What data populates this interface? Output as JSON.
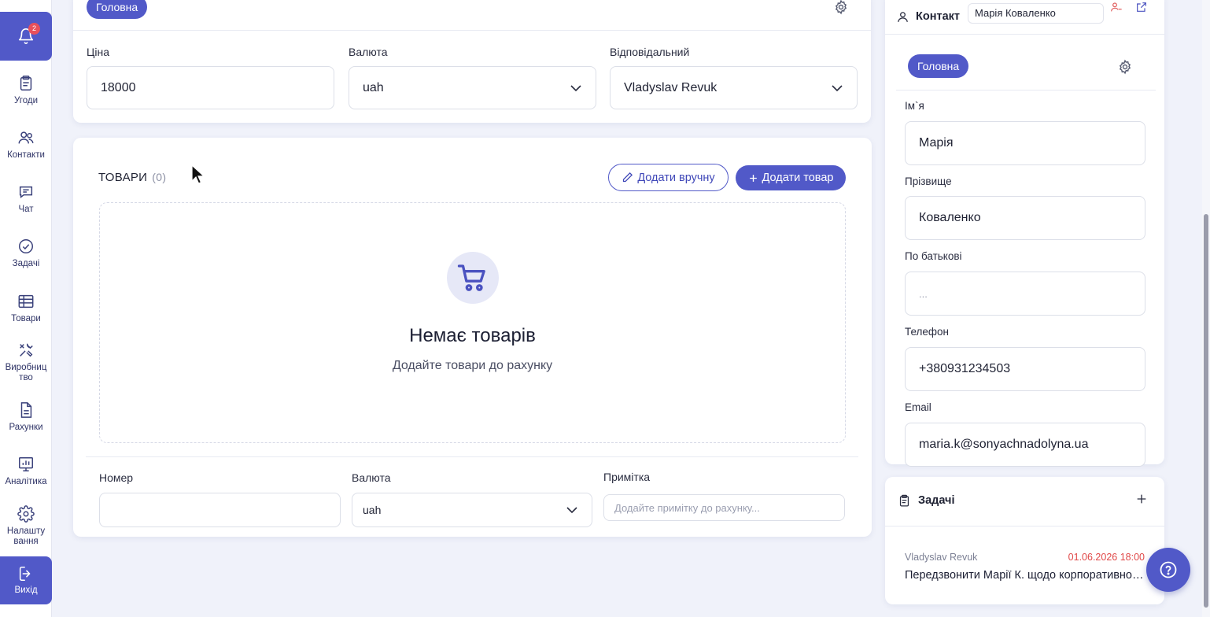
{
  "sidebar": {
    "notification_count": "2",
    "items": [
      {
        "label": "Угоди",
        "icon": "deals-icon"
      },
      {
        "label": "Контакти",
        "icon": "contacts-icon"
      },
      {
        "label": "Чат",
        "icon": "chat-icon"
      },
      {
        "label": "Задачі",
        "icon": "tasks-icon"
      },
      {
        "label": "Товари",
        "icon": "products-icon"
      },
      {
        "label": "Виробниц тво",
        "icon": "production-icon"
      },
      {
        "label": "Рахунки",
        "icon": "invoices-icon"
      },
      {
        "label": "Аналітика",
        "icon": "analytics-icon"
      },
      {
        "label": "Налашту вання",
        "icon": "settings-icon"
      }
    ],
    "logout_label": "Вихід"
  },
  "deal": {
    "tab_label": "Головна",
    "price_label": "Ціна",
    "price_value": "18000",
    "currency_label": "Валюта",
    "currency_value": "uah",
    "responsible_label": "Відповідальний",
    "responsible_value": "Vladyslav Revuk"
  },
  "goods": {
    "title": "ТОВАРИ",
    "count": "(0)",
    "add_manual_label": "Додати вручну",
    "add_product_label": "Додати товар",
    "empty_title": "Немає товарів",
    "empty_subtitle": "Додайте товари до рахунку",
    "number_label": "Номер",
    "number_value": "",
    "currency_label": "Валюта",
    "currency_value": "uah",
    "note_label": "Примітка",
    "note_placeholder": "Додайте примітку до рахунку..."
  },
  "contact": {
    "header_label": "Контакт",
    "header_value": "Марія Коваленко",
    "tab_label": "Головна",
    "first_name_label": "Ім`я",
    "first_name_value": "Марія",
    "last_name_label": "Прізвище",
    "last_name_value": "Коваленко",
    "patronymic_label": "По батькові",
    "patronymic_placeholder": "...",
    "phone_label": "Телефон",
    "phone_value": "+380931234503",
    "email_label": "Email",
    "email_value": "maria.k@sonyachnadolyna.ua"
  },
  "tasks": {
    "title": "Задачі",
    "items": [
      {
        "author": "Vladyslav Revuk",
        "due": "01.06.2026 18:00",
        "text": "Передзвонити Марії К. щодо корпоративного замовлення"
      }
    ]
  },
  "colors": {
    "accent": "#5159c8",
    "overdue": "#e04848",
    "background": "#f0f2fa"
  }
}
